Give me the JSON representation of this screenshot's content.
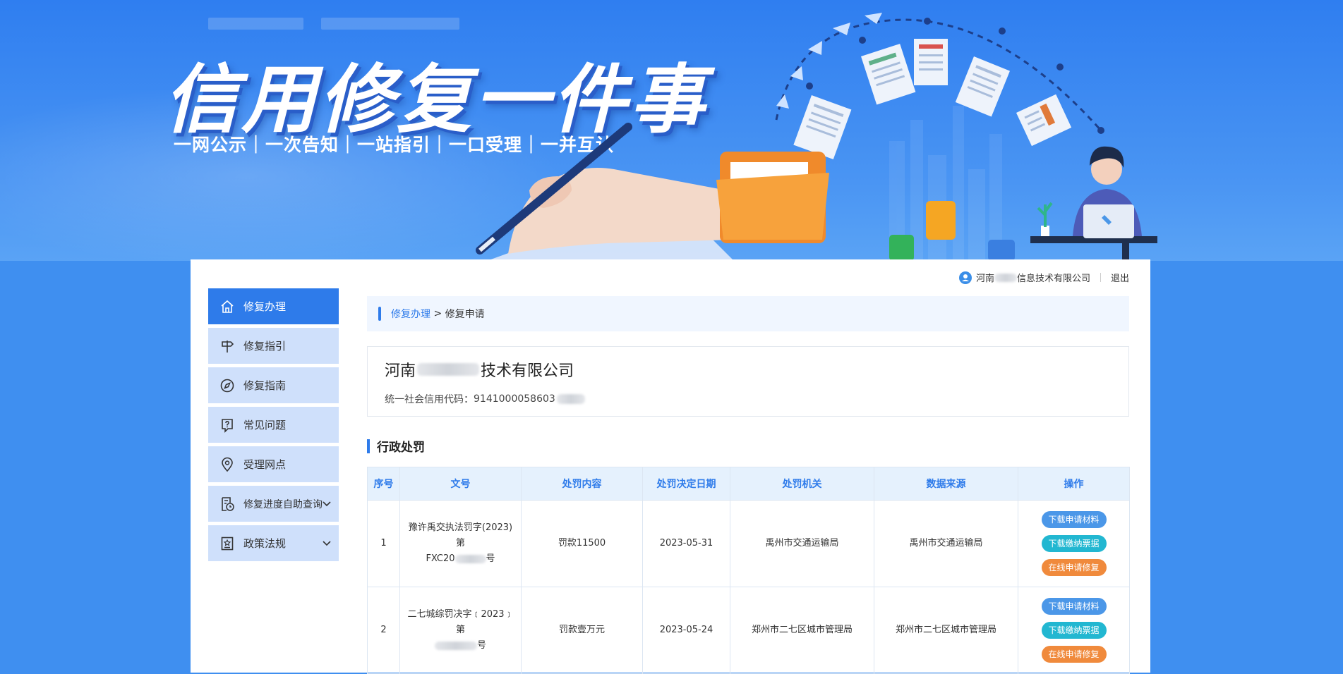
{
  "banner": {
    "title": "信用修复一件事",
    "slogan": "一网公示｜一次告知｜一站指引｜一口受理｜一并互认"
  },
  "user": {
    "company_prefix": "河南",
    "company_suffix": "信息技术有限公司",
    "logout_label": "退出"
  },
  "sidebar": {
    "items": [
      {
        "label": "修复办理",
        "icon": "home-icon",
        "active": true
      },
      {
        "label": "修复指引",
        "icon": "signpost-icon"
      },
      {
        "label": "修复指南",
        "icon": "compass-icon"
      },
      {
        "label": "常见问题",
        "icon": "question-icon"
      },
      {
        "label": "受理网点",
        "icon": "location-pin-icon"
      },
      {
        "label": "修复进度自助查询",
        "icon": "progress-query-icon",
        "expandable": true
      },
      {
        "label": "政策法规",
        "icon": "policy-icon",
        "expandable": true
      }
    ]
  },
  "breadcrumb": {
    "link": "修复办理",
    "separator": " > ",
    "current": "修复申请"
  },
  "company": {
    "name_prefix": "河南",
    "name_suffix": "技术有限公司",
    "code_label": "统一社会信用代码：",
    "code_value": "9141000058603"
  },
  "section": {
    "title": "行政处罚"
  },
  "table": {
    "headers": [
      "序号",
      "文号",
      "处罚内容",
      "处罚决定日期",
      "处罚机关",
      "数据来源",
      "操作"
    ],
    "rows": [
      {
        "index": "1",
        "doc_line1": "豫许禹交执法罚字(2023)第",
        "doc_line2_prefix": "FXC20",
        "doc_line2_suffix": "号",
        "content": "罚款11500",
        "date": "2023-05-31",
        "authority": "禹州市交通运输局",
        "source": "禹州市交通运输局"
      },
      {
        "index": "2",
        "doc_line1": "二七城综罚决字﹝2023﹞第",
        "doc_line2_prefix": "",
        "doc_line2_suffix": "号",
        "content": "罚款壹万元",
        "date": "2023-05-24",
        "authority": "郑州市二七区城市管理局",
        "source": "郑州市二七区城市管理局"
      }
    ],
    "actions": {
      "download_materials": "下载申请材料",
      "download_receipt": "下载缴纳票据",
      "apply_online": "在线申请修复"
    }
  },
  "colors": {
    "primary": "#2e7bea",
    "nav_bg": "#cfe0fb",
    "btn_blue": "#4b97e8",
    "btn_teal": "#22b7d1",
    "btn_orange": "#f08a3c"
  }
}
